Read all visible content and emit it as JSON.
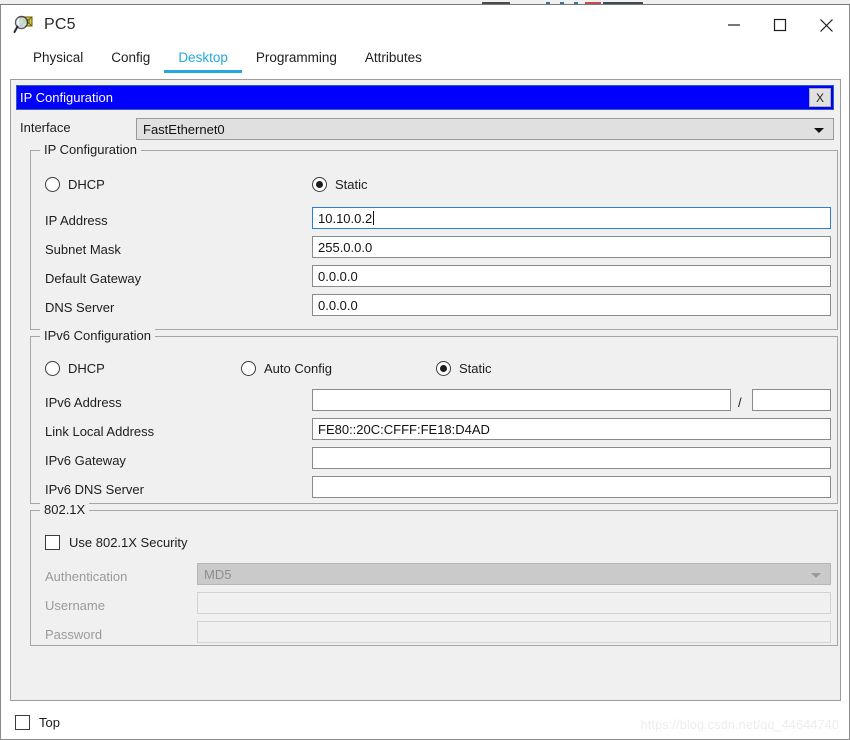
{
  "window": {
    "title": "PC5",
    "icon": "packet-tracer-pc-icon",
    "controls": {
      "minimize": "minimize-icon",
      "maximize": "maximize-icon",
      "close": "close-icon"
    }
  },
  "tabs": [
    {
      "label": "Physical",
      "active": false
    },
    {
      "label": "Config",
      "active": false
    },
    {
      "label": "Desktop",
      "active": true
    },
    {
      "label": "Programming",
      "active": false
    },
    {
      "label": "Attributes",
      "active": false
    }
  ],
  "panel": {
    "header_title": "IP Configuration",
    "close_label": "X",
    "interface": {
      "label": "Interface",
      "value": "FastEthernet0"
    }
  },
  "ipv4": {
    "legend": "IP Configuration",
    "dhcp": {
      "label": "DHCP",
      "selected": false
    },
    "static": {
      "label": "Static",
      "selected": true
    },
    "ip_address": {
      "label": "IP Address",
      "value": "10.10.0.2",
      "focused": true
    },
    "subnet_mask": {
      "label": "Subnet Mask",
      "value": "255.0.0.0"
    },
    "default_gateway": {
      "label": "Default Gateway",
      "value": "0.0.0.0"
    },
    "dns_server": {
      "label": "DNS Server",
      "value": "0.0.0.0"
    }
  },
  "ipv6": {
    "legend": "IPv6 Configuration",
    "dhcp": {
      "label": "DHCP",
      "selected": false
    },
    "auto_config": {
      "label": "Auto Config",
      "selected": false
    },
    "static": {
      "label": "Static",
      "selected": true
    },
    "ipv6_address": {
      "label": "IPv6 Address",
      "value": "",
      "prefix_separator": "/",
      "prefix_value": ""
    },
    "link_local_address": {
      "label": "Link Local Address",
      "value": "FE80::20C:CFFF:FE18:D4AD"
    },
    "ipv6_gateway": {
      "label": "IPv6 Gateway",
      "value": ""
    },
    "ipv6_dns_server": {
      "label": "IPv6 DNS Server",
      "value": ""
    }
  },
  "dot1x": {
    "legend": "802.1X",
    "use_security": {
      "label": "Use 802.1X Security",
      "checked": false
    },
    "authentication": {
      "label": "Authentication",
      "value": "MD5",
      "disabled": true
    },
    "username": {
      "label": "Username",
      "value": "",
      "disabled": true
    },
    "password": {
      "label": "Password",
      "value": "",
      "disabled": true
    }
  },
  "footer": {
    "top_checkbox": {
      "label": "Top",
      "checked": false
    },
    "watermark": "https://blog.csdn.net/qq_44644740"
  },
  "colors": {
    "accent": "#23a8de",
    "header_blue": "#0000ff",
    "focus_border": "#2a7fd4",
    "panel_bg": "#f0f0f0"
  }
}
